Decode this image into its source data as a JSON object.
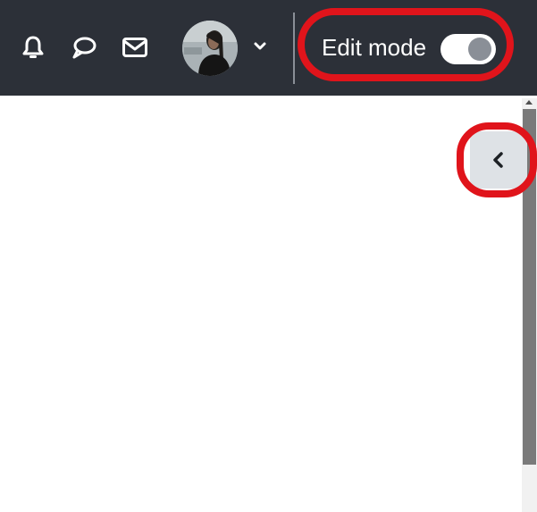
{
  "navbar": {
    "icons": [
      "bell-icon",
      "chat-bubble-icon",
      "envelope-icon"
    ],
    "user_menu": {
      "avatar": "user-avatar",
      "dropdown_icon": "chevron-down-icon"
    },
    "edit_mode": {
      "label": "Edit mode",
      "toggle_state": "off"
    }
  },
  "drawer": {
    "toggle_icon": "chevron-left-icon"
  },
  "colors": {
    "navbar_bg": "#2c3038",
    "highlight": "#e0141b",
    "toggle_track": "#ffffff",
    "toggle_knob": "#8a8f97",
    "drawer_button_bg": "#dee2e6"
  }
}
